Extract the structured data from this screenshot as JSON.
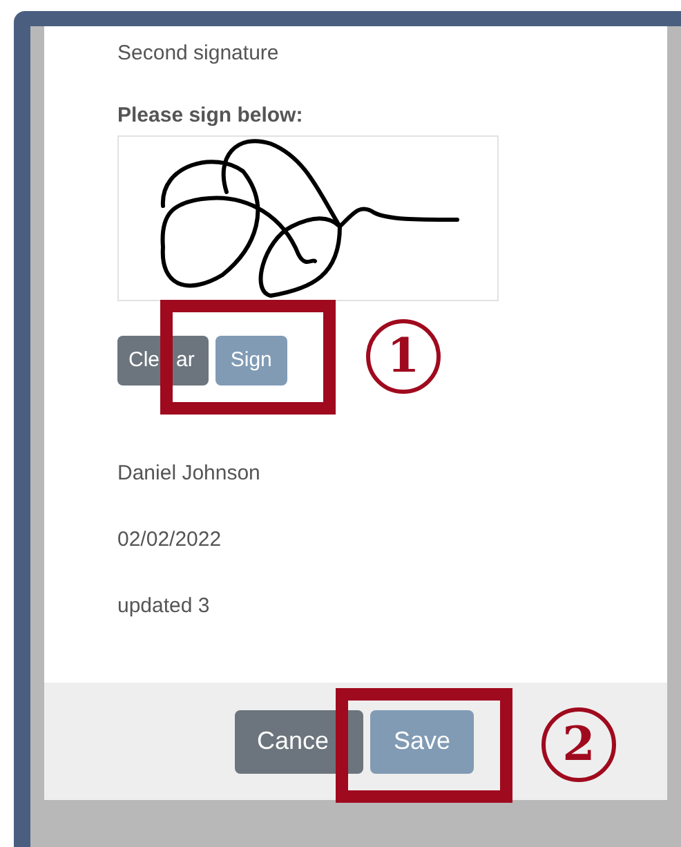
{
  "section_title": "Second signature",
  "signature": {
    "label": "Please sign below:"
  },
  "signature_buttons": [
    {
      "label": "Cle",
      "label_tail": "ar",
      "kind": "secondary"
    },
    {
      "label": "Sign",
      "kind": "primary"
    }
  ],
  "details": [
    "Daniel Johnson",
    "02/02/2022",
    "updated 3"
  ],
  "footer_buttons": [
    {
      "label": "Cance",
      "kind": "secondary"
    },
    {
      "label": "Save",
      "kind": "primary"
    }
  ],
  "callouts": [
    {
      "number": "1"
    },
    {
      "number": "2"
    }
  ]
}
